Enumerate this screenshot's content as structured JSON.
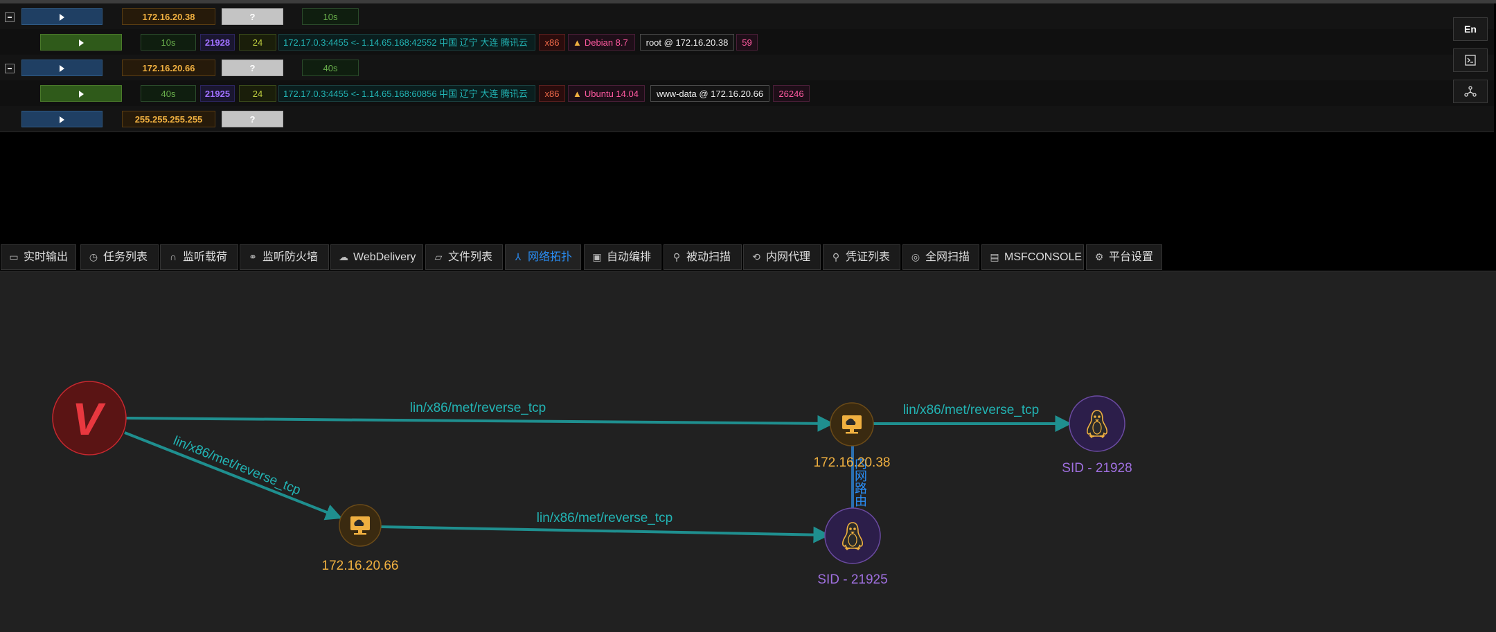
{
  "hosts": [
    {
      "ip": "172.16.20.38",
      "unknown": "?",
      "time": "10s",
      "session": {
        "time": "10s",
        "sid": "21928",
        "mask": "24",
        "connection": "172.17.0.3:4455 <- 1.14.65.168:42552 中国 辽宁 大连 腾讯云",
        "arch": "x86",
        "os": "Debian 8.7",
        "user": "root @ 172.16.20.38",
        "pid": "59"
      }
    },
    {
      "ip": "172.16.20.66",
      "unknown": "?",
      "time": "40s",
      "session": {
        "time": "40s",
        "sid": "21925",
        "mask": "24",
        "connection": "172.17.0.3:4455 <- 1.14.65.168:60856 中国 辽宁 大连 腾讯云",
        "arch": "x86",
        "os": "Ubuntu 14.04",
        "user": "www-data @ 172.16.20.66",
        "pid": "26246"
      }
    },
    {
      "ip": "255.255.255.255",
      "unknown": "?"
    }
  ],
  "side_buttons": {
    "lang": "En",
    "terminal_icon": "terminal-icon",
    "topology_icon": "topology-icon"
  },
  "tabs": [
    {
      "label": "实时输出",
      "icon": "monitor-icon"
    },
    {
      "label": "任务列表",
      "icon": "clock-icon"
    },
    {
      "label": "监听载荷",
      "icon": "headphones-icon"
    },
    {
      "label": "监听防火墙",
      "icon": "link-icon"
    },
    {
      "label": "WebDelivery",
      "icon": "cloud-icon"
    },
    {
      "label": "文件列表",
      "icon": "folder-icon"
    },
    {
      "label": "网络拓扑",
      "icon": "topology-icon",
      "active": true
    },
    {
      "label": "自动编排",
      "icon": "robot-icon"
    },
    {
      "label": "被动扫描",
      "icon": "search-icon"
    },
    {
      "label": "内网代理",
      "icon": "proxy-icon"
    },
    {
      "label": "凭证列表",
      "icon": "key-search-icon"
    },
    {
      "label": "全网扫描",
      "icon": "radar-icon"
    },
    {
      "label": "MSFCONSOLE",
      "icon": "console-icon"
    },
    {
      "label": "平台设置",
      "icon": "gear-icon"
    }
  ],
  "topology": {
    "root_label": "V",
    "hosts": [
      "172.16.20.38",
      "172.16.20.66"
    ],
    "sessions": [
      "SID - 21928",
      "SID - 21925"
    ],
    "edge_label": "lin/x86/met/reverse_tcp",
    "route_label": "内网路由",
    "colors": {
      "edge": "#1f8f8f",
      "host_label": "#f0b040",
      "session_label": "#a070e0",
      "root": "#c8282f",
      "route": "#2a6fb0"
    }
  }
}
